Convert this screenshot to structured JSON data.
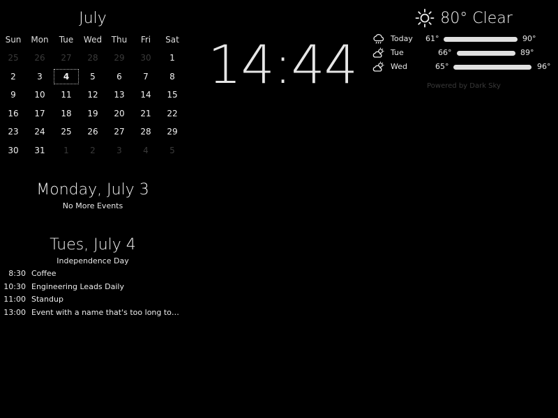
{
  "calendar": {
    "month": "July",
    "weekdays": [
      "Sun",
      "Mon",
      "Tue",
      "Wed",
      "Thu",
      "Fri",
      "Sat"
    ],
    "weeks": [
      [
        {
          "d": "25",
          "o": true
        },
        {
          "d": "26",
          "o": true
        },
        {
          "d": "27",
          "o": true
        },
        {
          "d": "28",
          "o": true
        },
        {
          "d": "29",
          "o": true
        },
        {
          "d": "30",
          "o": true
        },
        {
          "d": "1"
        }
      ],
      [
        {
          "d": "2"
        },
        {
          "d": "3"
        },
        {
          "d": "4",
          "today": true
        },
        {
          "d": "5"
        },
        {
          "d": "6"
        },
        {
          "d": "7"
        },
        {
          "d": "8"
        }
      ],
      [
        {
          "d": "9"
        },
        {
          "d": "10"
        },
        {
          "d": "11"
        },
        {
          "d": "12"
        },
        {
          "d": "13"
        },
        {
          "d": "14"
        },
        {
          "d": "15"
        }
      ],
      [
        {
          "d": "16"
        },
        {
          "d": "17"
        },
        {
          "d": "18"
        },
        {
          "d": "19"
        },
        {
          "d": "20"
        },
        {
          "d": "21"
        },
        {
          "d": "22"
        }
      ],
      [
        {
          "d": "23"
        },
        {
          "d": "24"
        },
        {
          "d": "25"
        },
        {
          "d": "26"
        },
        {
          "d": "27"
        },
        {
          "d": "28"
        },
        {
          "d": "29"
        }
      ],
      [
        {
          "d": "30"
        },
        {
          "d": "31"
        },
        {
          "d": "1",
          "o": true
        },
        {
          "d": "2",
          "o": true
        },
        {
          "d": "3",
          "o": true
        },
        {
          "d": "4",
          "o": true
        },
        {
          "d": "5",
          "o": true
        }
      ]
    ]
  },
  "clock": {
    "time": "14:44"
  },
  "today": {
    "title": "Monday, July 3",
    "note": "No More Events"
  },
  "tomorrow": {
    "title": "Tues, July 4",
    "allday": "Independence Day",
    "events": [
      {
        "time": "8:30",
        "name": "Coffee"
      },
      {
        "time": "10:30",
        "name": "Engineering Leads Daily"
      },
      {
        "time": "11:00",
        "name": "Standup"
      },
      {
        "time": "13:00",
        "name": "Event with a name that's too long to fit ..."
      }
    ]
  },
  "weather": {
    "current": "80° Clear",
    "current_icon": "sun-icon",
    "forecast": [
      {
        "day": "Today",
        "icon": "cloud-rain-icon",
        "low": "61°",
        "high": "90°"
      },
      {
        "day": "Tue",
        "icon": "partly-cloudy-icon",
        "low": "66°",
        "high": "89°"
      },
      {
        "day": "Wed",
        "icon": "partly-cloudy-icon",
        "low": "65°",
        "high": "96°"
      }
    ],
    "powered_by": "Powered by Dark Sky"
  }
}
